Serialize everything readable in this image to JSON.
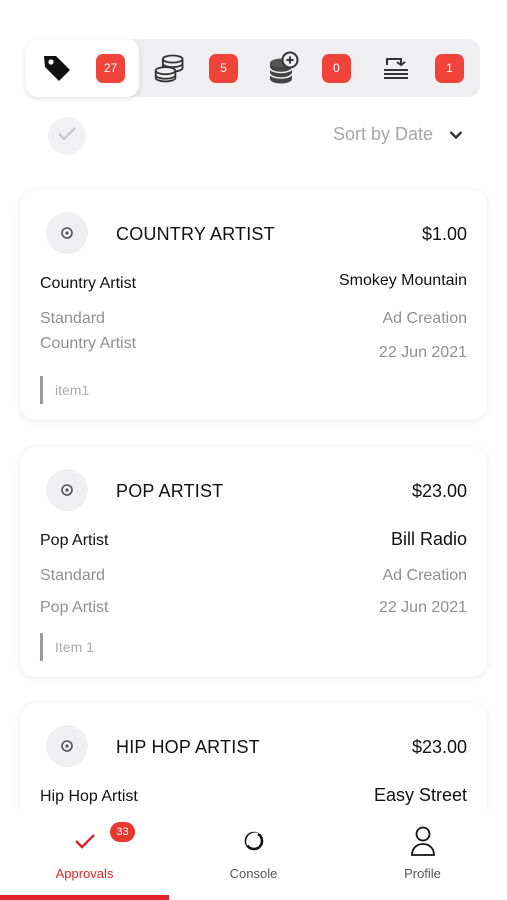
{
  "tabs": [
    {
      "icon": "tag-icon",
      "count": "27",
      "active": true
    },
    {
      "icon": "coins-stack-icon",
      "count": "5",
      "active": false
    },
    {
      "icon": "coins-add-icon",
      "count": "0",
      "active": false
    },
    {
      "icon": "transfer-icon",
      "count": "1",
      "active": false
    }
  ],
  "filter": {
    "sort_label": "Sort by Date"
  },
  "cards": [
    {
      "title": "COUNTRY ARTIST",
      "price": "$1.00",
      "left_1": "Country Artist",
      "right_1": "Smokey Mountain",
      "left_2": "Standard",
      "right_2": "Ad Creation",
      "left_3": "Country Artist",
      "right_3": "22 Jun 2021",
      "note": "item1"
    },
    {
      "title": "POP ARTIST",
      "price": "$23.00",
      "left_1": "Pop Artist",
      "right_1": "Bill Radio",
      "left_2": "Standard",
      "right_2": "Ad Creation",
      "left_3": "Pop Artist",
      "right_3": "22 Jun 2021",
      "note": "Item 1"
    },
    {
      "title": "HIP HOP ARTIST",
      "price": "$23.00",
      "left_1": "Hip Hop Artist",
      "right_1": "Easy Street"
    }
  ],
  "bottom_nav": [
    {
      "label": "Approvals",
      "icon": "check-icon",
      "badge": "33",
      "active": true
    },
    {
      "label": "Console",
      "icon": "console-icon",
      "active": false
    },
    {
      "label": "Profile",
      "icon": "user-icon",
      "active": false
    }
  ],
  "colors": {
    "accent": "#e0242c",
    "badge": "#f0433a",
    "muted": "#8f8f95"
  }
}
